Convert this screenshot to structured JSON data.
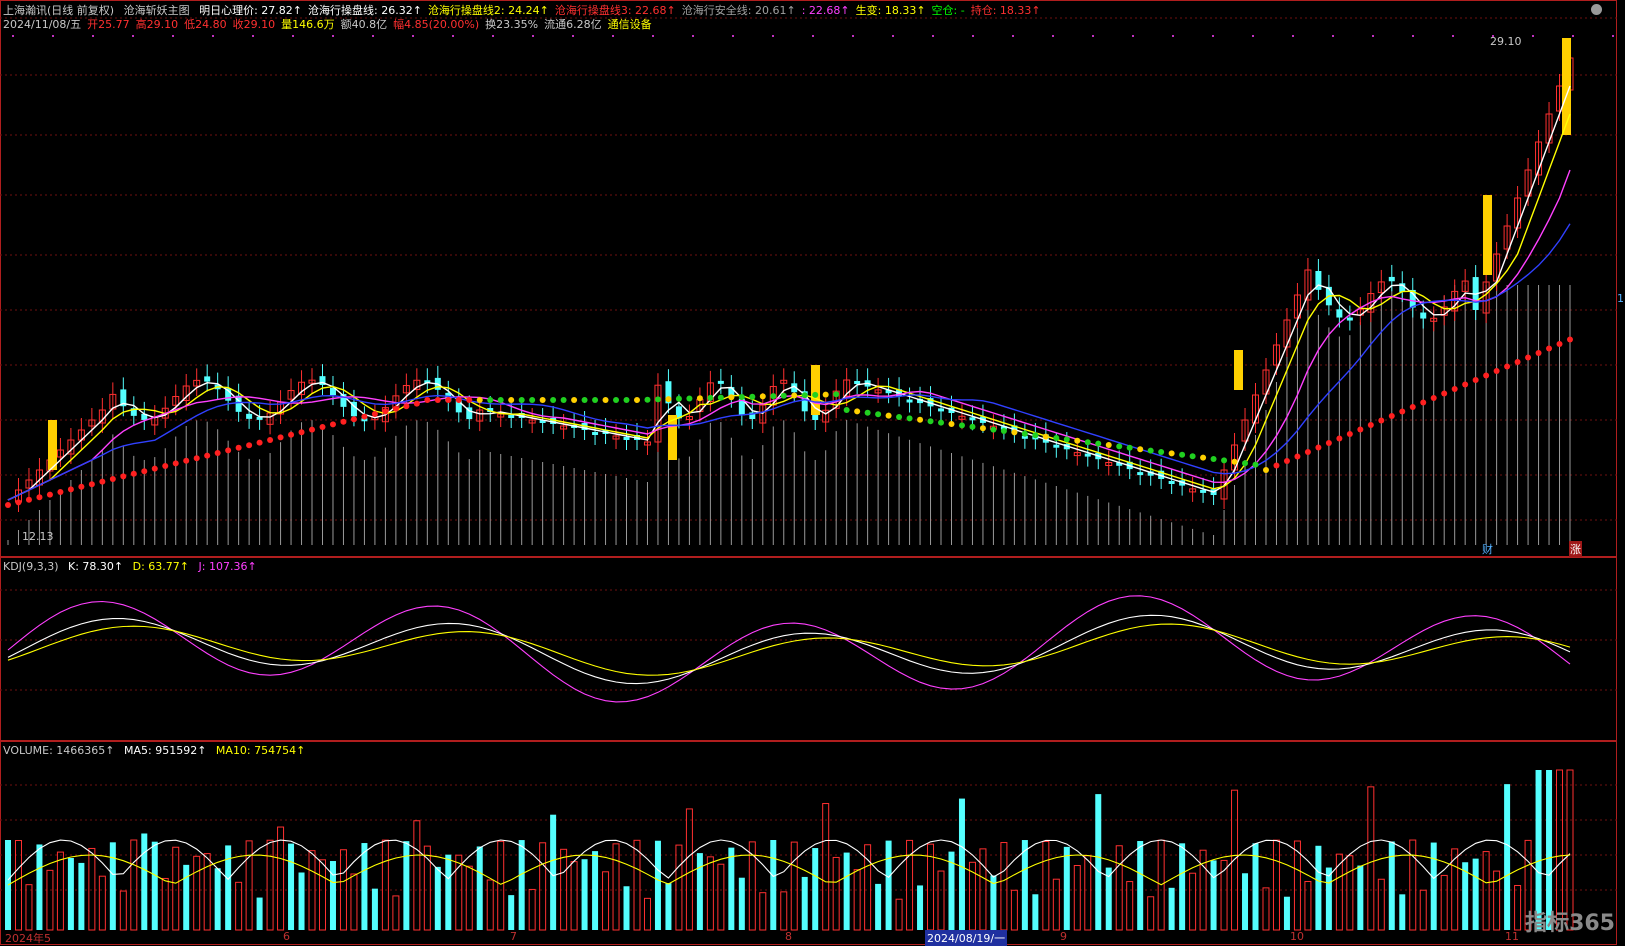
{
  "main": {
    "title": "上海瀚讯(日线 前复权)",
    "indicator": "沧海斩妖主图",
    "items": [
      {
        "label": "明日心理价: 27.82↑",
        "color": "#ffffff"
      },
      {
        "label": "沧海行操盘线: 26.32↑",
        "color": "#ffffff"
      },
      {
        "label": "沧海行操盘线2: 24.24↑",
        "color": "#ffff00"
      },
      {
        "label": "沧海行操盘线3: 22.68↑",
        "color": "#ff3030"
      },
      {
        "label": "沧海行安全线: 20.61↑",
        "color": "#a0a0a0"
      },
      {
        "label": ": 22.68↑",
        "color": "#ff40ff"
      },
      {
        "label": "生变: 18.33↑",
        "color": "#ffff00"
      },
      {
        "label": "空仓: -",
        "color": "#00ff00"
      },
      {
        "label": "持仓: 18.33↑",
        "color": "#ff3030"
      }
    ],
    "line2": [
      {
        "label": "2024/11/08/五",
        "color": "#c8c8c8"
      },
      {
        "label": "开25.77",
        "color": "#ff3030"
      },
      {
        "label": "高29.10",
        "color": "#ff3030"
      },
      {
        "label": "低24.80",
        "color": "#ff3030"
      },
      {
        "label": "收29.10",
        "color": "#ff3030"
      },
      {
        "label": "量146.6万",
        "color": "#ffff00"
      },
      {
        "label": "额40.8亿",
        "color": "#c8c8c8"
      },
      {
        "label": "幅4.85(20.00%)",
        "color": "#ff3030"
      },
      {
        "label": "换23.35%",
        "color": "#c8c8c8"
      },
      {
        "label": "流通6.28亿",
        "color": "#c8c8c8"
      },
      {
        "label": "通信设备",
        "color": "#ffff00"
      }
    ],
    "high_label": "29.10",
    "low_label": "12.13",
    "tag_cai": "财",
    "tag_zhang": "涨",
    "side_mark": "1"
  },
  "kdj": {
    "name": "KDJ(9,3,3)",
    "k": "K: 78.30↑",
    "d": "D: 63.77↑",
    "j": "J: 107.36↑"
  },
  "volume": {
    "name": "VOLUME: 1466365↑",
    "ma5": "MA5: 951592↑",
    "ma10": "MA10: 754754↑"
  },
  "xaxis": {
    "labels": [
      "2024年5",
      "6",
      "7",
      "8",
      "2024/08/19/一",
      "9",
      "10",
      "11"
    ]
  },
  "watermark": "指标365",
  "colors": {
    "up": "#ff3030",
    "down": "#54ffff",
    "bg": "#000000",
    "grid": "#6e1010"
  }
}
